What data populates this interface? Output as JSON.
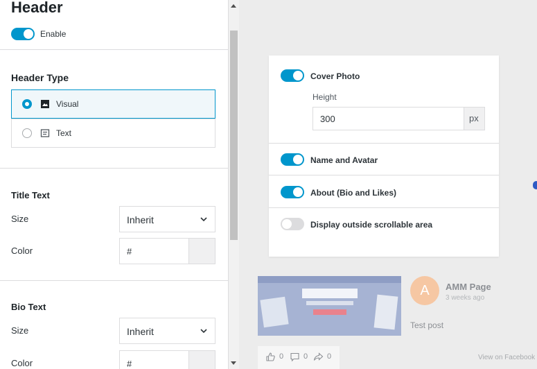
{
  "settings": {
    "title": "Header",
    "enable_label": "Enable",
    "header_type": {
      "title": "Header Type",
      "options": [
        {
          "label": "Visual",
          "selected": true,
          "icon": "image-icon"
        },
        {
          "label": "Text",
          "selected": false,
          "icon": "text-icon"
        }
      ]
    },
    "title_text": {
      "title": "Title Text",
      "size_label": "Size",
      "size_value": "Inherit",
      "color_label": "Color",
      "color_value": "#"
    },
    "bio_text": {
      "title": "Bio Text",
      "size_label": "Size",
      "size_value": "Inherit",
      "color_label": "Color",
      "color_value": "#"
    }
  },
  "preview": {
    "cover_photo_label": "Cover Photo",
    "height_label": "Height",
    "height_value": "300",
    "height_unit": "px",
    "name_avatar_label": "Name and Avatar",
    "about_label": "About (Bio and Likes)",
    "outside_scroll_label": "Display outside scrollable area",
    "toggles": {
      "cover_photo": true,
      "name_avatar": true,
      "about": true,
      "outside_scroll": false
    }
  },
  "feed": {
    "avatar_letter": "A",
    "page_name": "AMM Page",
    "time_ago": "3 weeks ago",
    "post_text": "Test post",
    "likes": "0",
    "comments": "0",
    "shares": "0",
    "view_link": "View on Facebook"
  },
  "colors": {
    "accent": "#0096cc",
    "avatar_bg": "#f6c7a3"
  }
}
